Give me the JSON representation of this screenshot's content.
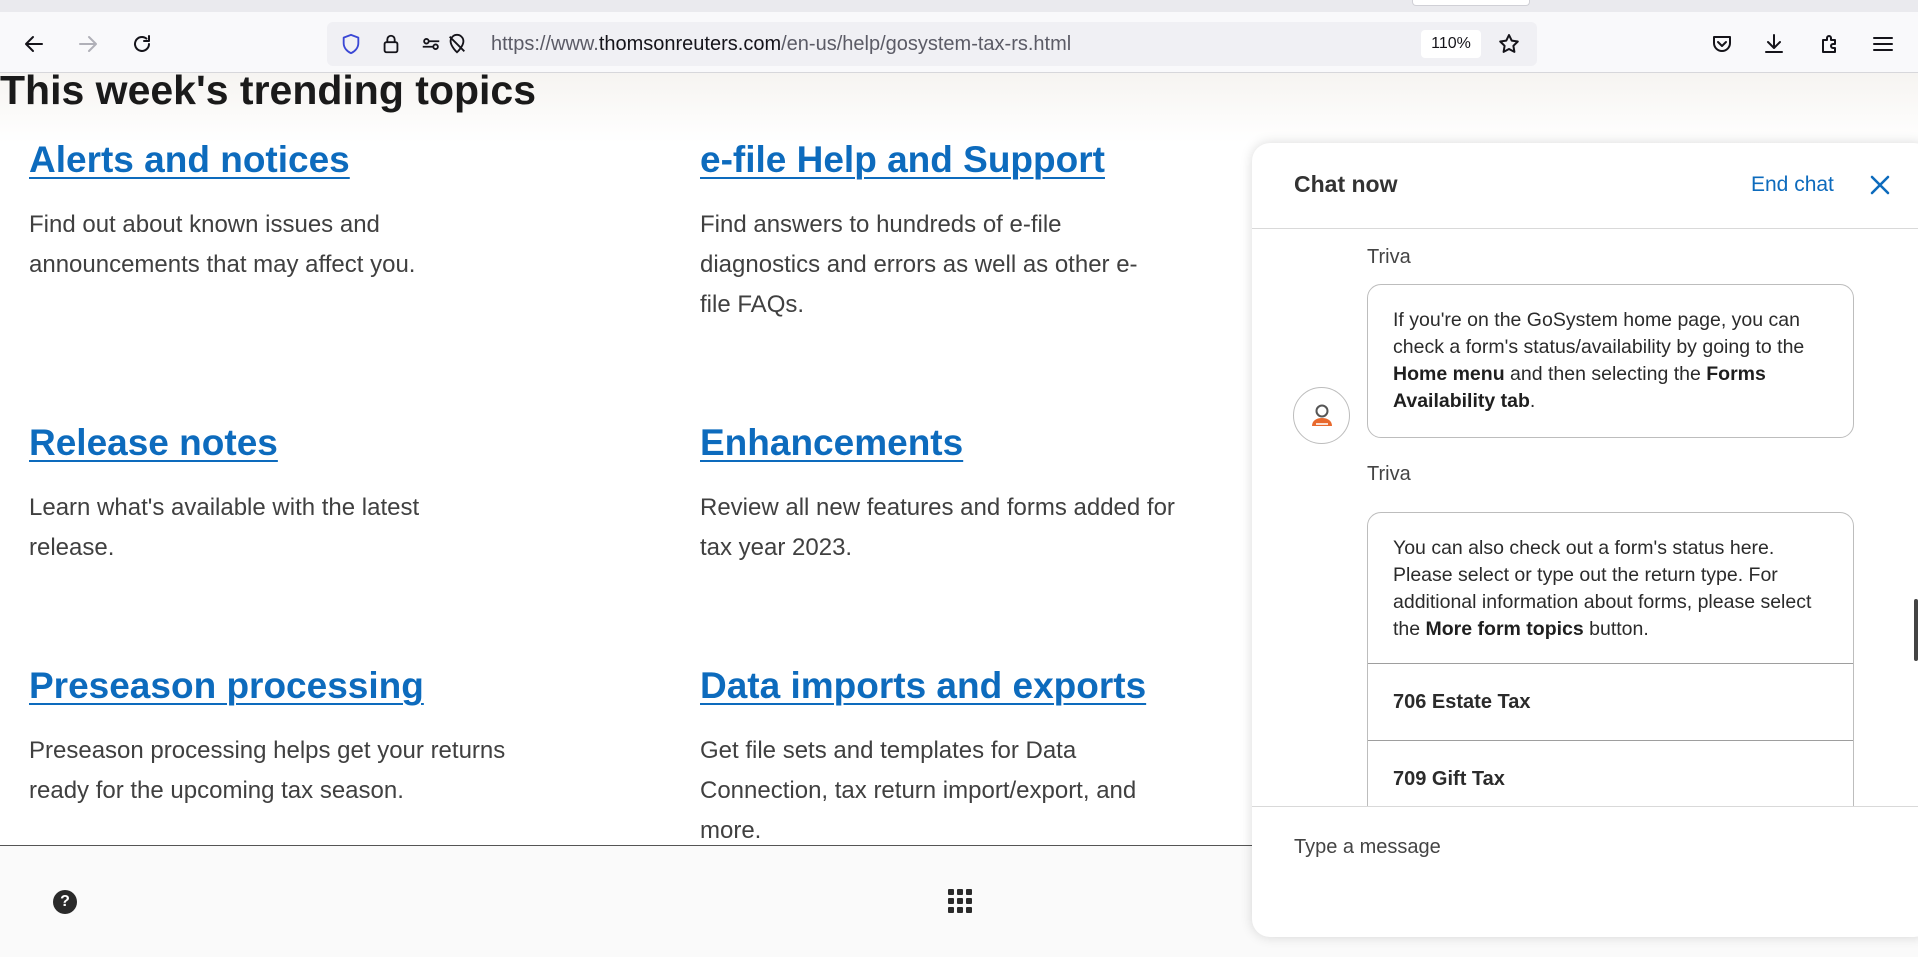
{
  "browser": {
    "url_prefix": "https://www.",
    "url_host": "thomsonreuters.com",
    "url_path": "/en-us/help/gosystem-tax-rs.html",
    "zoom": "110%"
  },
  "page": {
    "section_title": "This week's trending topics",
    "topics": [
      {
        "title": "Alerts and notices",
        "desc": "Find out about known issues and announcements that may affect you."
      },
      {
        "title": "e-file Help and Support",
        "desc": "Find answers to hundreds of e-file diagnostics and errors as well as other e-file FAQs."
      },
      {
        "title": "Release notes",
        "desc": "Learn what's available with the latest release."
      },
      {
        "title": "Enhancements",
        "desc": "Review all new features and forms added for tax year 2023."
      },
      {
        "title": "Preseason processing",
        "desc": "Preseason processing helps get your returns ready for the upcoming tax season."
      },
      {
        "title": "Data imports and exports",
        "desc": "Get file sets and templates for Data Connection, tax return import/export, and more."
      }
    ],
    "help_icon_glyph": "?"
  },
  "chat": {
    "title": "Chat now",
    "end_chat": "End chat",
    "messages": [
      {
        "sender": "Triva",
        "p1": "If you're on the GoSystem home page, you can check a form's status/availability by going to the ",
        "b1": "Home menu",
        "p2": " and then selecting the ",
        "b2": "Forms Availability tab",
        "p3": "."
      },
      {
        "sender": "Triva",
        "p1": "You can also check out a form's status here. Please select or type out the return type. For additional information about forms, please select the ",
        "b1": "More form topics",
        "p2": " button.",
        "options": [
          "706 Estate Tax",
          "709 Gift Tax"
        ]
      }
    ],
    "input_placeholder": "Type a message"
  }
}
